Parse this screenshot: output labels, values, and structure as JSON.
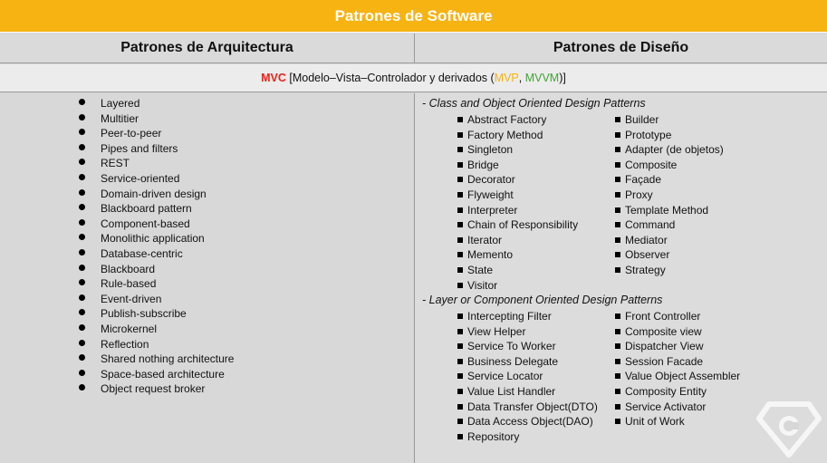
{
  "title": "Patrones de Software",
  "headers": {
    "left": "Patrones de Arquitectura",
    "right": "Patrones de Diseño"
  },
  "mvc": {
    "mvc": "MVC",
    "t1": " [Modelo–Vista–Controlador y derivados (",
    "mvp": "MVP",
    "comma": ", ",
    "mvvm": "MVVM",
    "t2": ")]",
    "colors": {
      "mvc": "#e8231c",
      "mvp": "#f2b318",
      "mvvm": "#3fa535"
    }
  },
  "architecture": [
    "Layered",
    "Multitier",
    "Peer-to-peer",
    "Pipes and filters",
    "REST",
    "Service-oriented",
    "Domain-driven design",
    "Blackboard pattern",
    "Component-based",
    "Monolithic application",
    "Database-centric",
    "Blackboard",
    "Rule-based",
    "Event-driven",
    "Publish-subscribe",
    "Microkernel",
    "Reflection",
    "Shared nothing architecture",
    "Space-based architecture",
    "Object request broker"
  ],
  "design": {
    "class_title": "- Class and Object Oriented Design Patterns",
    "class_col1": [
      "Abstract Factory",
      "Factory Method",
      "Singleton",
      "Bridge",
      "Decorator",
      "Flyweight",
      "Interpreter",
      "Chain of Responsibility",
      "Iterator",
      "Memento",
      "State",
      "Visitor"
    ],
    "class_col2": [
      "Builder",
      "Prototype",
      "Adapter (de objetos)",
      "Composite",
      "Façade",
      "Proxy",
      "Template Method",
      "Command",
      "Mediator",
      "Observer",
      "Strategy"
    ],
    "layer_title": "- Layer or Component Oriented Design Patterns",
    "layer_col1": [
      "Intercepting Filter",
      "View Helper",
      "Service To Worker",
      "Business Delegate",
      "Service Locator",
      "Value List Handler",
      "Data Transfer Object(DTO)",
      "Data Access Object(DAO)",
      "Repository"
    ],
    "layer_col2": [
      "Front Controller",
      "Composite view",
      "Dispatcher View",
      "Session Facade",
      "Value Object Assembler",
      "Composity Entity",
      "Service Activator",
      "Unit of Work"
    ]
  },
  "colors": {
    "header": "#f6b312"
  },
  "logo_icon": "diamond-c-logo-icon"
}
